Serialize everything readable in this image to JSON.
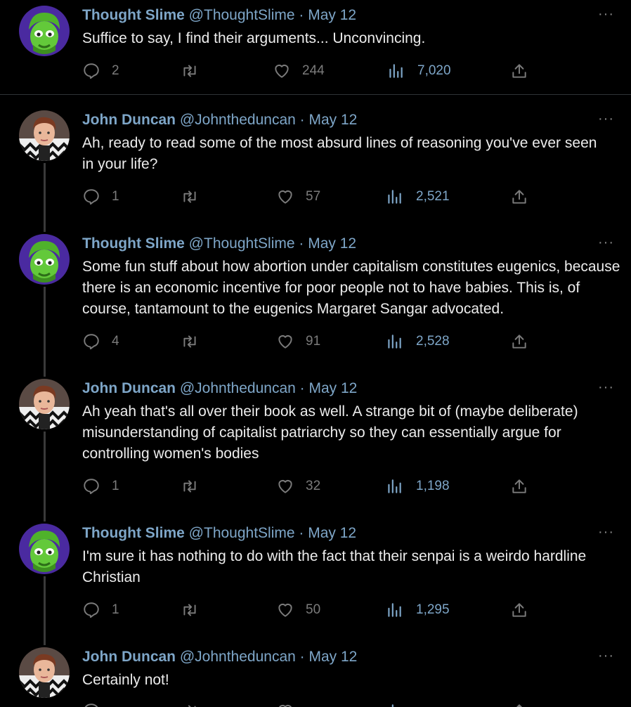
{
  "tweets": [
    {
      "name": "Thought Slime",
      "handle": "@ThoughtSlime",
      "sep": "·",
      "date": "May 12",
      "avatar": "green-character-avatar",
      "text": "Suffice to say, I find their arguments... Unconvincing.",
      "replies": "2",
      "retweets": "",
      "likes": "244",
      "views": "7,020"
    },
    {
      "name": "John Duncan",
      "handle": "@Johntheduncan",
      "sep": "·",
      "date": "May 12",
      "avatar": "photo-avatar",
      "text": "Ah, ready to read some of the most absurd lines of reasoning you've ever seen in your life?",
      "replies": "1",
      "retweets": "",
      "likes": "57",
      "views": "2,521"
    },
    {
      "name": "Thought Slime",
      "handle": "@ThoughtSlime",
      "sep": "·",
      "date": "May 12",
      "avatar": "green-character-avatar",
      "text": "Some fun stuff about how abortion under capitalism constitutes eugenics, because there is an economic incentive for poor people not to have babies. This is, of course, tantamount to the eugenics Margaret Sangar advocated.",
      "replies": "4",
      "retweets": "",
      "likes": "91",
      "views": "2,528"
    },
    {
      "name": "John Duncan",
      "handle": "@Johntheduncan",
      "sep": "·",
      "date": "May 12",
      "avatar": "photo-avatar",
      "text": "Ah yeah that's all over their book as well. A strange bit of (maybe deliberate) misunderstanding of capitalist patriarchy so they can essentially argue for controlling women's bodies",
      "replies": "1",
      "retweets": "",
      "likes": "32",
      "views": "1,198"
    },
    {
      "name": "Thought Slime",
      "handle": "@ThoughtSlime",
      "sep": "·",
      "date": "May 12",
      "avatar": "green-character-avatar",
      "text": "I'm sure it has nothing to do with the fact that their senpai is a weirdo hardline Christian",
      "replies": "1",
      "retweets": "",
      "likes": "50",
      "views": "1,295"
    },
    {
      "name": "John Duncan",
      "handle": "@Johntheduncan",
      "sep": "·",
      "date": "May 12",
      "avatar": "photo-avatar",
      "text": "Certainly not!",
      "replies": "",
      "retweets": "",
      "likes": "",
      "views": ""
    }
  ],
  "more_label": "···",
  "icons": [
    "reply-icon",
    "retweet-icon",
    "like-icon",
    "views-icon",
    "share-icon",
    "more-icon"
  ],
  "colors": {
    "background": "#000000",
    "name_blue": "#7ea6c8",
    "text": "#ececec",
    "muted": "#7b7b7b"
  }
}
